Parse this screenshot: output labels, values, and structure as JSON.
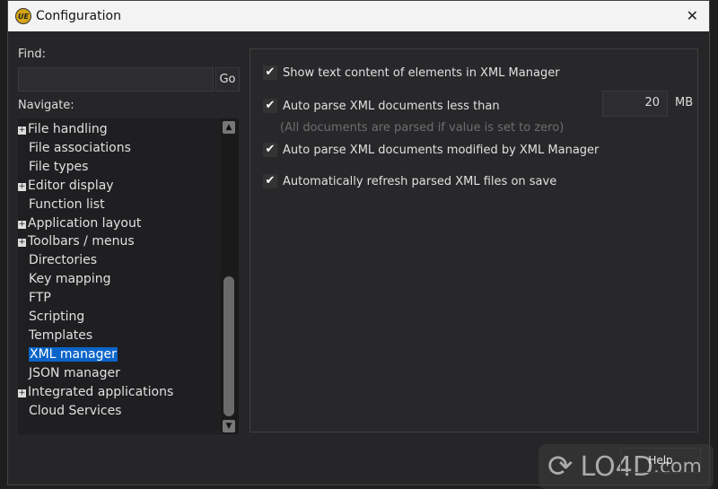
{
  "window": {
    "title": "Configuration",
    "icon_text": "UE",
    "close": "✕"
  },
  "find": {
    "label": "Find:",
    "value": "",
    "go_label": "Go"
  },
  "navigate": {
    "label": "Navigate:",
    "items": [
      {
        "label": "File handling",
        "expandable": true
      },
      {
        "label": "File associations",
        "expandable": false
      },
      {
        "label": "File types",
        "expandable": false
      },
      {
        "label": "Editor display",
        "expandable": true
      },
      {
        "label": "Function list",
        "expandable": false
      },
      {
        "label": "Application layout",
        "expandable": true
      },
      {
        "label": "Toolbars / menus",
        "expandable": true
      },
      {
        "label": "Directories",
        "expandable": false
      },
      {
        "label": "Key mapping",
        "expandable": false
      },
      {
        "label": "FTP",
        "expandable": false
      },
      {
        "label": "Scripting",
        "expandable": false
      },
      {
        "label": "Templates",
        "expandable": false
      },
      {
        "label": "XML manager",
        "expandable": false,
        "selected": true
      },
      {
        "label": "JSON manager",
        "expandable": false
      },
      {
        "label": "Integrated applications",
        "expandable": true
      },
      {
        "label": "Cloud Services",
        "expandable": false
      }
    ]
  },
  "options": {
    "show_text": {
      "label": "Show text content of elements in XML Manager",
      "checked": true
    },
    "auto_parse_less": {
      "label": "Auto parse XML documents less than",
      "checked": true,
      "value": "20",
      "unit": "MB",
      "hint": "(All documents are parsed if value is set to zero)"
    },
    "auto_parse_modified": {
      "label": "Auto parse XML documents modified by XML Manager",
      "checked": true
    },
    "auto_refresh": {
      "label": "Automatically refresh parsed XML files on save",
      "checked": true
    }
  },
  "buttons": {
    "help": "Help"
  },
  "watermark": "LO4D.com",
  "colors": {
    "selection": "#0a64c8",
    "background": "#262628"
  }
}
